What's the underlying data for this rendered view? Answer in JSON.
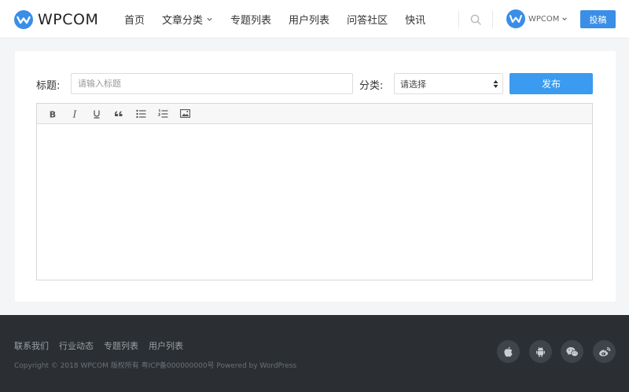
{
  "header": {
    "logo_text": "WPCOM",
    "nav": [
      {
        "label": "首页"
      },
      {
        "label": "文章分类"
      },
      {
        "label": "专题列表"
      },
      {
        "label": "用户列表"
      },
      {
        "label": "问答社区"
      },
      {
        "label": "快讯"
      }
    ],
    "user_name": "WPCOM",
    "submit_label": "投稿"
  },
  "form": {
    "title_label": "标题:",
    "title_placeholder": "请输入标题",
    "title_value": "",
    "category_label": "分类:",
    "category_selected": "请选择",
    "publish_label": "发布"
  },
  "toolbar": {
    "tools": [
      "bold-icon",
      "italic-icon",
      "underline-icon",
      "quote-icon",
      "bulleted-list-icon",
      "numbered-list-icon",
      "image-icon"
    ]
  },
  "footer": {
    "links": [
      "联系我们",
      "行业动态",
      "专题列表",
      "用户列表"
    ],
    "copyright": "Copyright © 2018 WPCOM 版权所有 粤ICP备000000000号 Powered by WordPress",
    "social": [
      "apple-icon",
      "android-icon",
      "wechat-icon",
      "weibo-icon"
    ]
  },
  "colors": {
    "accent": "#3a8ee6",
    "publish": "#3a9bf0",
    "footer_bg": "#2b2f33"
  }
}
